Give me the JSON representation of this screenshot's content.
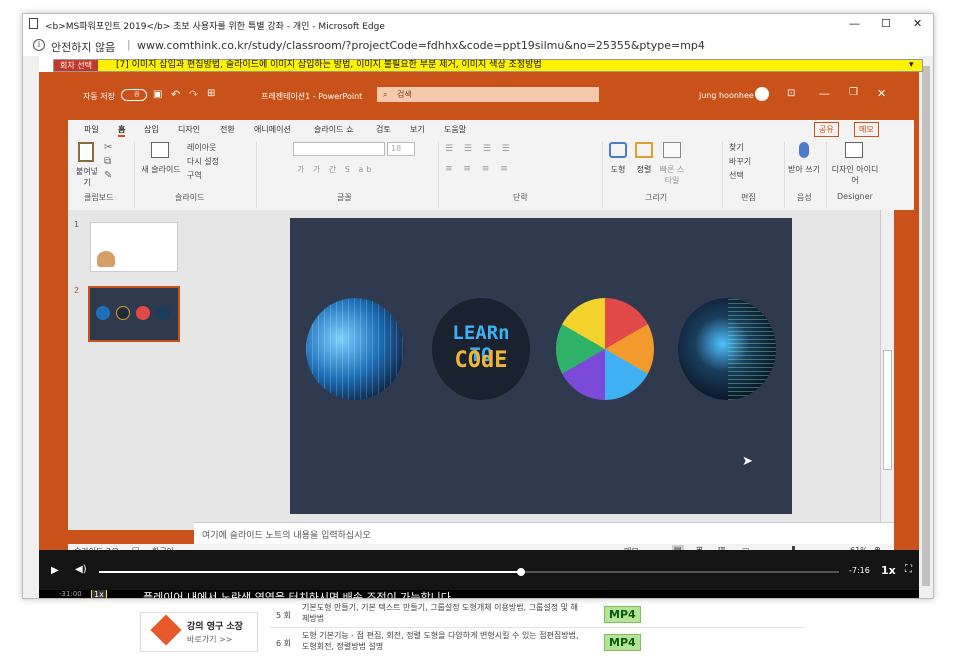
{
  "window": {
    "title": "<b>MS파워포인트 2019</b> 초보 사용자를 위한 특별 강좌 - 개인 - Microsoft Edge",
    "minimize": "—",
    "maximize": "☐",
    "close": "✕"
  },
  "address": {
    "security": "안전하지 않음",
    "url": "www.comthink.co.kr/study/classroom/?projectCode=fdhhx&code=ppt19silmu&no=25355&ptype=mp4"
  },
  "course": {
    "select_label": "회차 선택",
    "lesson": "[7] 이미지 삽입과 편집방법, 슬라이드에 이미지 삽입하는 방법, 이미지 불필요한 부분 제거, 이미지 색상 조정방법"
  },
  "ppt": {
    "autosave": "자동 저장",
    "autosave_state": "끔",
    "doc_title": "프레젠테이션1 - PowerPoint",
    "search_placeholder": "검색",
    "user": "jung hoonhee",
    "share": "공유",
    "memo": "메모",
    "tabs": [
      "파일",
      "홈",
      "삽입",
      "디자인",
      "전환",
      "애니메이션",
      "슬라이드 쇼",
      "검토",
      "보기",
      "도움말"
    ],
    "ribbon": {
      "paste": "붙여넣기",
      "clipboard": "클립보드",
      "new_slide": "새 슬라이드",
      "layout": "레이아웃",
      "reset": "다시 설정",
      "section": "구역",
      "slides": "슬라이드",
      "font": "글꼴",
      "font_size": "18",
      "paragraph": "단락",
      "shapes": "도형",
      "arrange": "정렬",
      "quick_styles": "빠른 스타일",
      "drawing": "그리기",
      "find": "찾기",
      "replace": "바꾸기",
      "select": "선택",
      "editing": "편집",
      "dictate": "받아 쓰기",
      "voice": "음성",
      "design_ideas": "디자인 아이디어",
      "designer": "Designer"
    },
    "thumbs": [
      {
        "num": "1"
      },
      {
        "num": "2"
      }
    ],
    "slide_images": [
      "binary-sphere",
      "LEARN TO CODE",
      "programming-languages",
      "matrix-eye"
    ],
    "code_text_1": "LEARn TO",
    "code_text_2": "COdE",
    "notes": "여기에 슬라이드 노트의 내용을 입력하십시오",
    "status": {
      "slide": "슬라이드 2/2",
      "lang": "한국어",
      "notes_btn": "메모",
      "zoom": "61%"
    }
  },
  "player": {
    "remaining": "-7:16",
    "speed": "1x",
    "progress": 0.57,
    "left_time": "-31:00",
    "left_speed": "1x",
    "subtitle": "플레이어 내에서 노란색 영역을 터치하시면 배속 조정이 가능합니다"
  },
  "below": {
    "banner_title": "강의 영구 소장",
    "banner_link": "바로가기 >>",
    "rows": [
      {
        "num": "5 회",
        "text": "기본도형 만들기, 기본 텍스트 만들기, 그룹설정 도형개체 이용방법, 그룹설정 및 해제방법",
        "badge": "MP4"
      },
      {
        "num": "6 회",
        "text": "도형 기본기능 - 점 편집, 회전, 정렬 도형을 다양하게 변형시킬 수 있는 점편집방법, 도형회전, 정렬방법 설명",
        "badge": "MP4"
      }
    ]
  },
  "colors": {
    "accent": "#c9521b",
    "slide_bg": "#2f3a4f",
    "course_bar": "#fff200",
    "mp4_bg": "#b6e39a"
  }
}
